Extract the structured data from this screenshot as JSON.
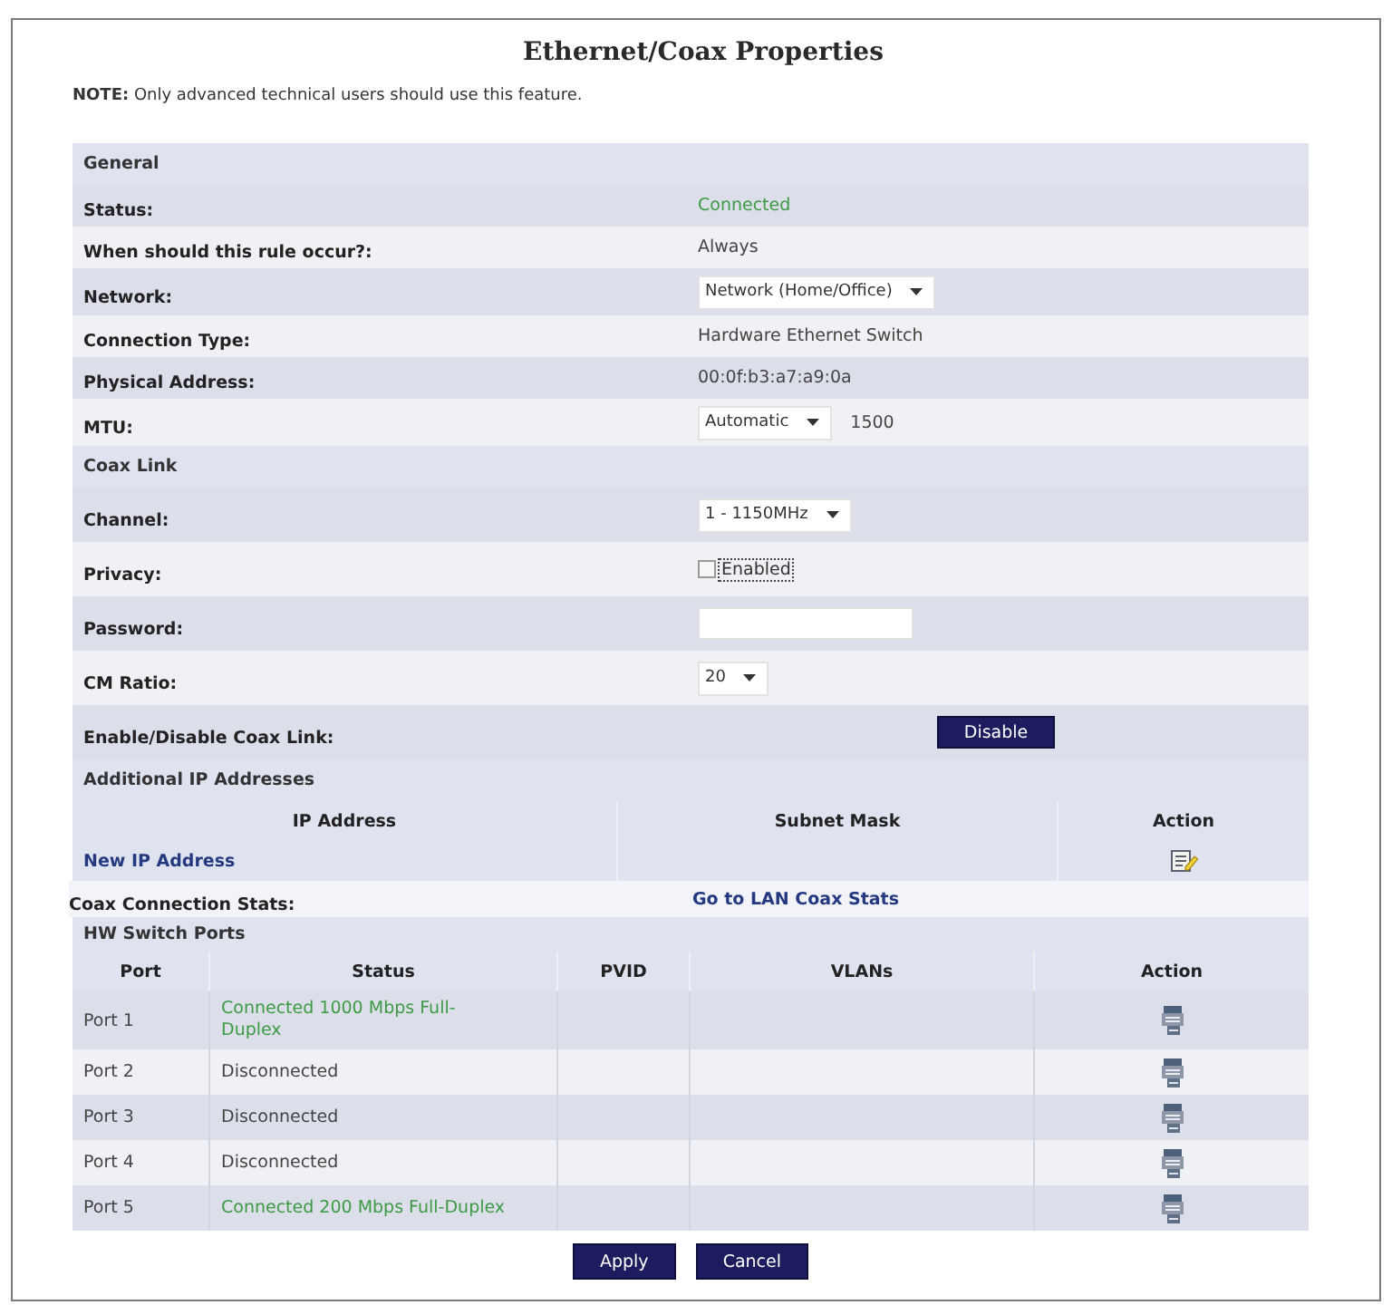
{
  "title": "Ethernet/Coax Properties",
  "note": "**NOTE:** Only advanced technical users should use this feature.",
  "general": {
    "heading": "General",
    "rows": [
      {
        "kind": "status",
        "label": "Status:",
        "value": "Connected",
        "connected": true
      },
      {
        "kind": "text",
        "label": "When should this rule occur?:",
        "value": "Always"
      },
      {
        "kind": "select",
        "label": "Network:",
        "value": "Network (Home/Office)"
      },
      {
        "kind": "text",
        "label": "Connection Type:",
        "value": "Hardware Ethernet Switch"
      },
      {
        "kind": "text",
        "label": "Physical Address:",
        "value": "00:0f:b3:a7:a9:0a"
      },
      {
        "kind": "select",
        "label": "MTU:",
        "value": "Automatic",
        "extra": "1500"
      }
    ]
  },
  "coax_link": {
    "heading": "Coax Link",
    "rows": [
      {
        "kind": "select",
        "label": "Channel:",
        "value": "1 - 1150MHz"
      },
      {
        "kind": "checkbox",
        "label": "Privacy:",
        "option": "Enabled",
        "checked": false
      },
      {
        "kind": "input",
        "label": "Password:"
      },
      {
        "kind": "select",
        "label": "CM Ratio:",
        "value": "20"
      },
      {
        "kind": "button",
        "label": "Enable/Disable Coax Link:",
        "button": "Disable"
      }
    ]
  },
  "additional_ip_addresses": {
    "heading": "Additional IP Addresses",
    "columns": [
      "IP Address",
      "Subnet Mask",
      "Action"
    ],
    "rows": [
      {
        "ip_address": "New IP Address"
      }
    ]
  },
  "coax_connection_stats": {
    "label": "Coax Connection Stats:",
    "link": "Go to LAN Coax Stats"
  },
  "hw_switch_ports": {
    "heading": "HW Switch Ports",
    "columns": [
      "Port",
      "Status",
      "PVID",
      "VLANs",
      "Action"
    ],
    "rows": [
      {
        "port": "Port 1",
        "status": "Connected 1000 Mbps Full-Duplex",
        "connected": true
      },
      {
        "port": "Port 2",
        "status": "Disconnected",
        "connected": false
      },
      {
        "port": "Port 3",
        "status": "Disconnected",
        "connected": false
      },
      {
        "port": "Port 4",
        "status": "Disconnected",
        "connected": false
      },
      {
        "port": "Port 5",
        "status": "Connected 200 Mbps Full-Duplex",
        "connected": true
      }
    ]
  },
  "buttons": [
    "Apply",
    "Cancel"
  ]
}
